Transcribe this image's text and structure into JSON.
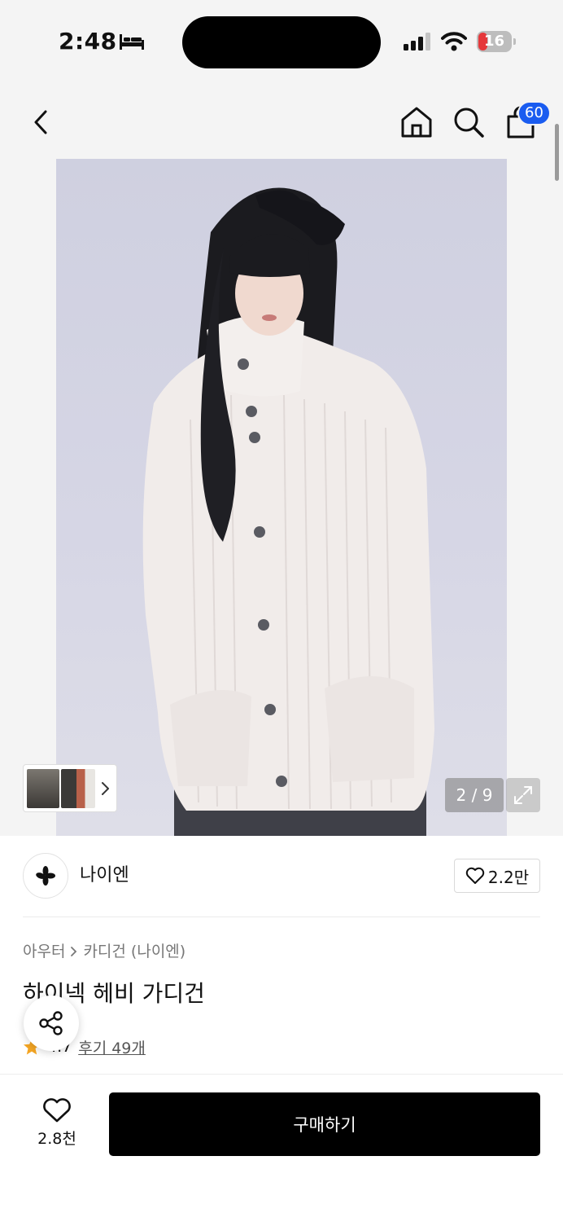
{
  "status_bar": {
    "time": "2:48",
    "battery_level": "16"
  },
  "header": {
    "cart_count": "60"
  },
  "gallery": {
    "page_counter": "2 / 9"
  },
  "brand": {
    "name": "나이엔",
    "like_count": "2.2만"
  },
  "product": {
    "breadcrumb": [
      "아우터",
      "카디건 (나이엔)"
    ],
    "title": "하이넥 헤비 가디건",
    "rating": "4.7",
    "review_label": "후기 49개"
  },
  "bottom_bar": {
    "wish_count": "2.8천",
    "buy_label": "구매하기"
  },
  "colors": {
    "badge": "#1a5cf0",
    "star": "#f5a623",
    "buy_button": "#000000"
  }
}
